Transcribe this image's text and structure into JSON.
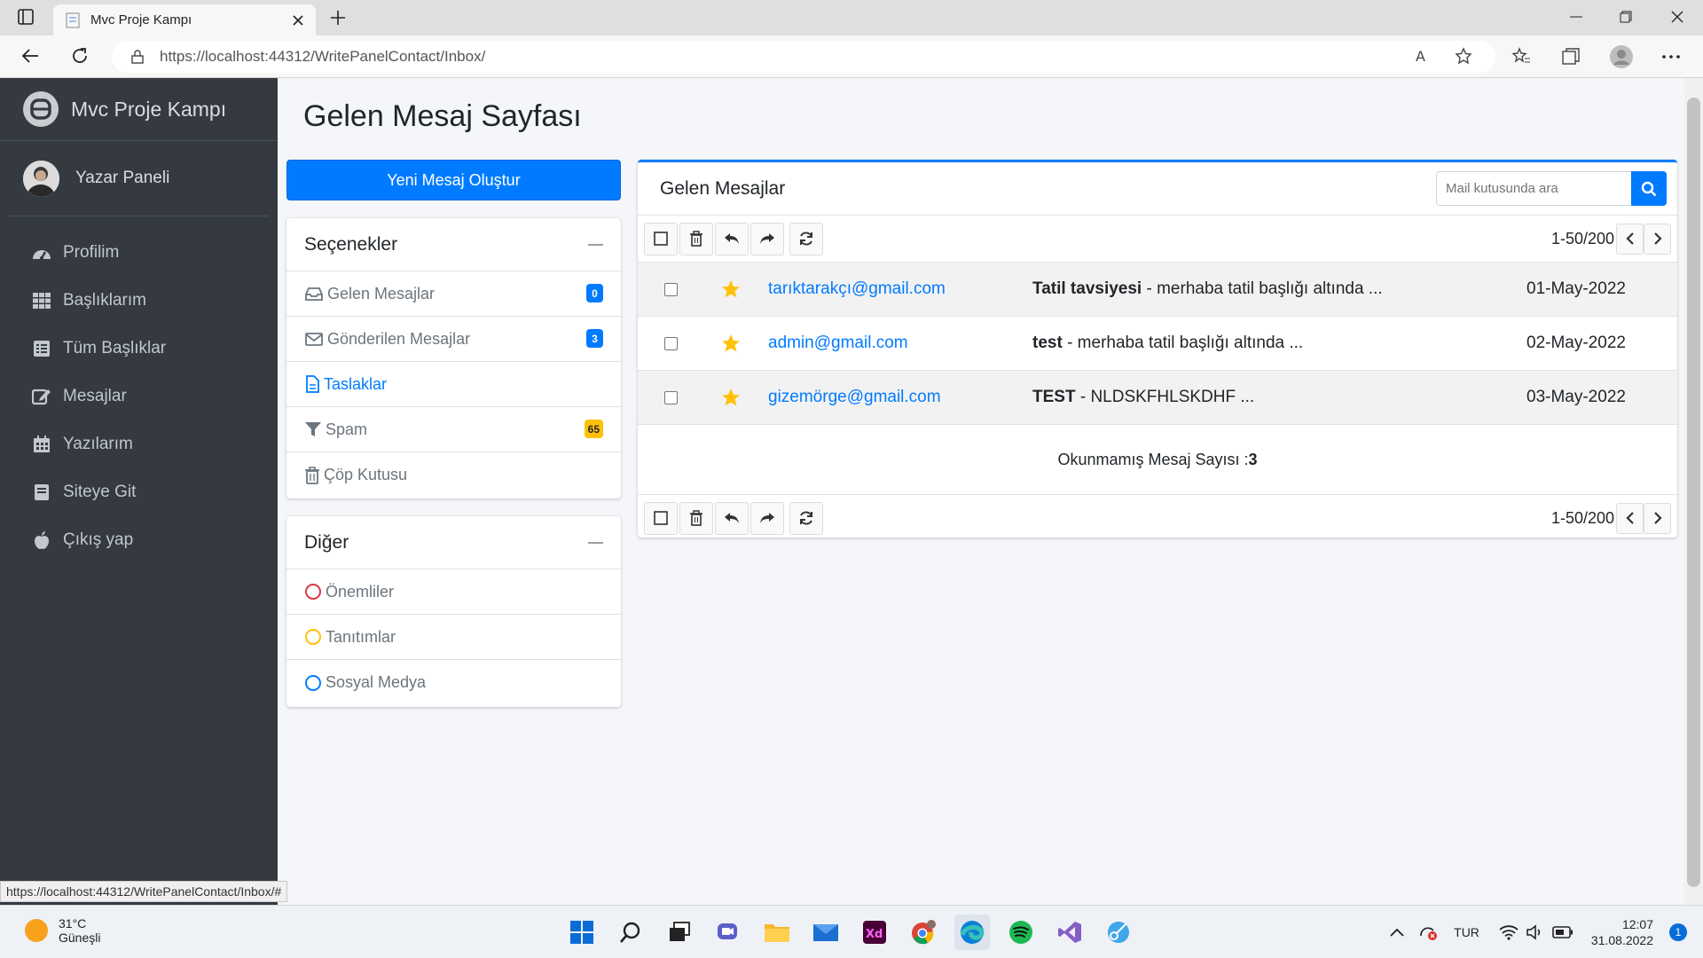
{
  "browser": {
    "tab_title": "Mvc Proje Kampı",
    "url": "https://localhost:44312/WritePanelContact/Inbox/",
    "status_url": "https://localhost:44312/WritePanelContact/Inbox/#"
  },
  "sidebar": {
    "brand": "Mvc Proje Kampı",
    "user": "Yazar Paneli",
    "items": [
      {
        "label": "Profilim",
        "icon": "dashboard-icon"
      },
      {
        "label": "Başlıklarım",
        "icon": "grid-icon"
      },
      {
        "label": "Tüm Başlıklar",
        "icon": "list-icon"
      },
      {
        "label": "Mesajlar",
        "icon": "edit-icon"
      },
      {
        "label": "Yazılarım",
        "icon": "calendar-icon"
      },
      {
        "label": "Siteye Git",
        "icon": "book-icon"
      },
      {
        "label": "Çıkış yap",
        "icon": "apple-icon"
      }
    ]
  },
  "page": {
    "title": "Gelen Mesaj Sayfası",
    "new_message": "Yeni Mesaj Oluştur"
  },
  "options": {
    "header": "Seçenekler",
    "items": [
      {
        "label": "Gelen Mesajlar",
        "badge": "0",
        "badge_color": "#007bff"
      },
      {
        "label": "Gönderilen Mesajlar",
        "badge": "3",
        "badge_color": "#007bff"
      },
      {
        "label": "Taslaklar"
      },
      {
        "label": "Spam",
        "badge": "65",
        "badge_color": "#ffc107"
      },
      {
        "label": "Çöp Kutusu"
      }
    ]
  },
  "other": {
    "header": "Diğer",
    "items": [
      {
        "label": "Önemliler",
        "color": "#dc3545"
      },
      {
        "label": "Tanıtımlar",
        "color": "#ffc107"
      },
      {
        "label": "Sosyal Medya",
        "color": "#007bff"
      }
    ]
  },
  "mail": {
    "header": "Gelen Mesajlar",
    "search_placeholder": "Mail kutusunda ara",
    "pager": "1-50/200",
    "rows": [
      {
        "from": "tarıktarakçı@gmail.com",
        "subject": "Tatil tavsiyesi",
        "preview": " - merhaba tatil başlığı altında ...",
        "date": "01-May-2022"
      },
      {
        "from": "admin@gmail.com",
        "subject": "test",
        "preview": " - merhaba tatil başlığı altında ...",
        "date": "02-May-2022"
      },
      {
        "from": "gizemörge@gmail.com",
        "subject": "TEST",
        "preview": " - NLDSKFHLSKDHF ...",
        "date": "03-May-2022"
      }
    ],
    "unread_label": "Okunmamış Mesaj Sayısı : ",
    "unread_count": "3"
  },
  "taskbar": {
    "temp": "31°C",
    "weather": "Güneşli",
    "lang": "TUR",
    "time": "12:07",
    "date": "31.08.2022",
    "notif": "1"
  }
}
